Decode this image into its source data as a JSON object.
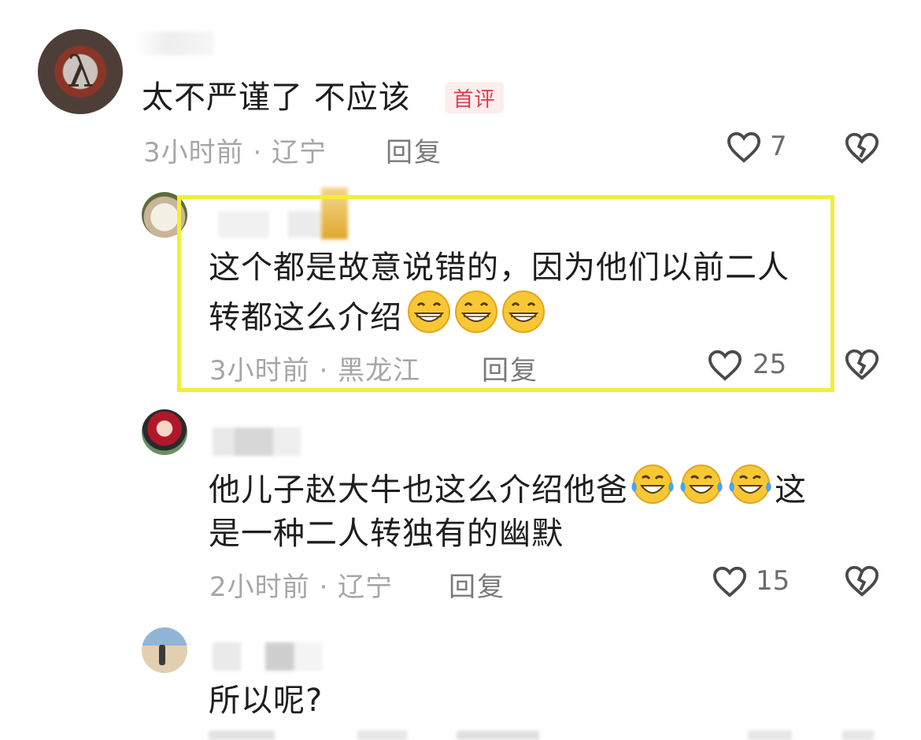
{
  "comments": [
    {
      "text": "太不严谨了 不应该",
      "badge": "首评",
      "time_location": "3小时前 · 辽宁",
      "reply_label": "回复",
      "likes": "7"
    },
    {
      "line1": "这个都是故意说错的，因为他们以前二人",
      "line2": "转都这么介绍",
      "emoji": [
        "grin-emoji",
        "grin-emoji",
        "grin-emoji"
      ],
      "time_location": "3小时前 · 黑龙江",
      "reply_label": "回复",
      "likes": "25"
    },
    {
      "line1_start": "他儿子赵大牛也这么介绍他爸",
      "line1_end": "这",
      "line2": "是一种二人转独有的幽默",
      "emoji": [
        "laugh-cry-emoji",
        "laugh-cry-emoji",
        "laugh-cry-emoji"
      ],
      "time_location": "2小时前 · 辽宁",
      "reply_label": "回复",
      "likes": "15"
    },
    {
      "text": "所以呢?"
    }
  ],
  "colors": {
    "highlight": "#f2ee3a",
    "badge_text": "#e33b4c",
    "badge_bg": "#fdeeee",
    "meta_gray": "#a6a6a6"
  },
  "icons": [
    "heart-outline-icon",
    "broken-heart-icon"
  ]
}
